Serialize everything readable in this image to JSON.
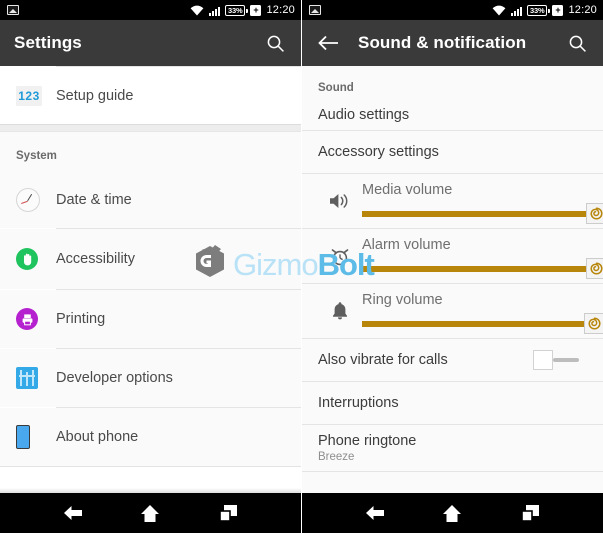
{
  "statusbar": {
    "photo_icon": "photo-icon",
    "wifi_icon": "wifi-icon",
    "signal_icon": "cellular-signal-icon",
    "battery_level": "33%",
    "battery_plug": "+",
    "time": "12:20"
  },
  "watermark": {
    "part1": "Gizmo",
    "part2": "Bolt"
  },
  "left": {
    "header": {
      "title": "Settings",
      "search_icon": "search-icon"
    },
    "section_label": "System",
    "items": [
      {
        "label": "Setup guide",
        "icon": "numeric-123-icon",
        "icon_text": "123"
      },
      {
        "label": "Date & time",
        "icon": "clock-icon"
      },
      {
        "label": "Accessibility",
        "icon": "accessibility-hand-icon"
      },
      {
        "label": "Printing",
        "icon": "printer-icon"
      },
      {
        "label": "Developer options",
        "icon": "developer-options-icon"
      },
      {
        "label": "About phone",
        "icon": "phone-device-icon"
      }
    ]
  },
  "right": {
    "header": {
      "title": "Sound & notification",
      "back_icon": "back-arrow-icon",
      "search_icon": "search-icon"
    },
    "section_label": "Sound",
    "items": [
      {
        "label": "Audio settings"
      },
      {
        "label": "Accessory settings"
      }
    ],
    "volumes": [
      {
        "label": "Media volume",
        "icon": "speaker-icon",
        "value": 98
      },
      {
        "label": "Alarm volume",
        "icon": "alarm-clock-icon",
        "value": 98
      },
      {
        "label": "Ring volume",
        "icon": "bell-icon",
        "value": 97
      }
    ],
    "vibrate": {
      "label": "Also vibrate for calls",
      "state": "off"
    },
    "interruptions": {
      "label": "Interruptions"
    },
    "ringtone": {
      "label": "Phone ringtone",
      "value": "Breeze"
    }
  },
  "navbar": {
    "back": "nav-back-icon",
    "home": "nav-home-icon",
    "recents": "nav-recents-icon"
  },
  "colors": {
    "actionbar": "#3a3a3a",
    "slider": "#b8860b",
    "accent_blue": "#1f9bd8",
    "green": "#1fc45f",
    "purple": "#b520cf"
  }
}
